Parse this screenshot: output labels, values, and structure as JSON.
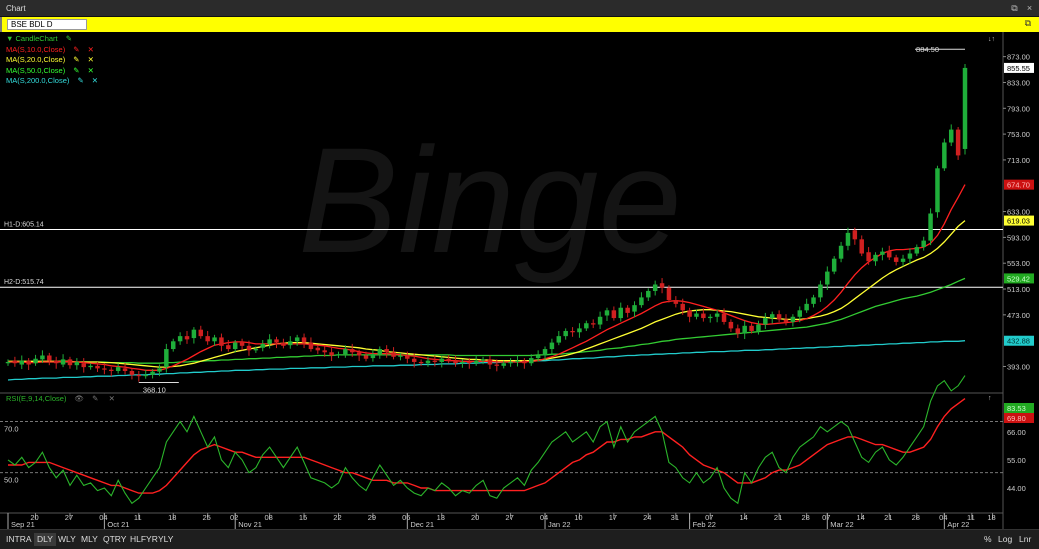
{
  "window": {
    "title": "Chart",
    "restore_glyph": "⧉",
    "close_glyph": "×",
    "undock_glyph": "⧉"
  },
  "symbol_bar": {
    "symbol": "BSE BDL D"
  },
  "watermark": "Binge",
  "legend": {
    "main": "▼ CandleChart",
    "studies": [
      {
        "label": "MA(S,10.0,Close)",
        "color": "#ff2020"
      },
      {
        "label": "MA(S,20.0,Close)",
        "color": "#ffff33"
      },
      {
        "label": "MA(S,50.0,Close)",
        "color": "#33ff33"
      },
      {
        "label": "MA(S,200.0,Close)",
        "color": "#33dddd"
      }
    ],
    "rsi": "RSI(E,9,14,Close)"
  },
  "colors": {
    "up": "#1fae3a",
    "down": "#d02020",
    "ma10": "#ff2020",
    "ma20": "#ffff33",
    "ma50": "#33cc33",
    "ma200": "#22cccc",
    "rsi": "#2bb52b",
    "rsi_sig": "#ff2020",
    "axis_text": "#cccccc",
    "hline": "#ffffff"
  },
  "chart_data": {
    "type": "candlestick",
    "y_ticks": [
      "873.00",
      "833.00",
      "793.00",
      "753.00",
      "713.00",
      "633.00",
      "593.00",
      "553.00",
      "513.00",
      "473.00",
      "393.00"
    ],
    "ylim": [
      355,
      905
    ],
    "last_price_label": "855.55",
    "ma_badges": [
      {
        "label": "674.70",
        "value": 674.7,
        "bg": "#cc1111",
        "fg": "#ffbbbb"
      },
      {
        "label": "619.03",
        "value": 619.03,
        "bg": "#ffff33",
        "fg": "#000000"
      },
      {
        "label": "529.42",
        "value": 529.42,
        "bg": "#22aa22",
        "fg": "#ccffcc"
      },
      {
        "label": "432.88",
        "value": 432.88,
        "bg": "#22cccc",
        "fg": "#003333"
      }
    ],
    "high_label": "884.50",
    "low_label": "368.10",
    "hlines": [
      {
        "label": "H1-D:605.14",
        "value": 605.14
      },
      {
        "label": "H2-D:515.74",
        "value": 515.74
      }
    ],
    "closes": [
      400,
      398,
      402,
      396,
      405,
      410,
      402,
      398,
      404,
      395,
      400,
      392,
      394,
      390,
      388,
      386,
      392,
      386,
      380,
      378,
      380,
      385,
      390,
      420,
      432,
      440,
      435,
      450,
      440,
      432,
      438,
      425,
      420,
      430,
      425,
      418,
      420,
      428,
      435,
      430,
      425,
      432,
      438,
      430,
      420,
      418,
      415,
      410,
      412,
      420,
      415,
      410,
      405,
      412,
      420,
      415,
      408,
      410,
      405,
      400,
      398,
      402,
      400,
      405,
      402,
      398,
      400,
      398,
      402,
      404,
      396,
      394,
      398,
      400,
      402,
      398,
      406,
      410,
      420,
      430,
      440,
      448,
      446,
      452,
      460,
      458,
      470,
      480,
      468,
      484,
      476,
      488,
      500,
      510,
      520,
      515,
      496,
      490,
      480,
      470,
      475,
      468,
      470,
      475,
      462,
      452,
      444,
      456,
      448,
      458,
      468,
      474,
      466,
      462,
      470,
      480,
      490,
      500,
      520,
      540,
      560,
      580,
      600,
      590,
      568,
      556,
      566,
      571,
      562,
      555,
      560,
      568,
      578,
      588,
      630,
      700,
      740,
      760,
      720,
      855.55
    ],
    "opens": [
      398,
      402,
      396,
      402,
      398,
      404,
      410,
      402,
      396,
      404,
      395,
      398,
      392,
      394,
      390,
      388,
      386,
      390,
      386,
      380,
      378,
      380,
      385,
      392,
      420,
      432,
      440,
      437,
      450,
      440,
      432,
      438,
      426,
      420,
      430,
      425,
      418,
      422,
      428,
      435,
      430,
      426,
      432,
      438,
      430,
      422,
      418,
      415,
      410,
      412,
      420,
      415,
      410,
      406,
      412,
      420,
      415,
      408,
      410,
      405,
      400,
      398,
      402,
      400,
      405,
      402,
      398,
      400,
      398,
      402,
      404,
      396,
      394,
      398,
      400,
      402,
      398,
      406,
      410,
      420,
      430,
      440,
      448,
      446,
      452,
      460,
      458,
      472,
      480,
      468,
      484,
      478,
      488,
      500,
      510,
      522,
      515,
      496,
      490,
      480,
      470,
      475,
      468,
      470,
      475,
      462,
      452,
      444,
      456,
      448,
      458,
      468,
      474,
      466,
      462,
      470,
      480,
      490,
      500,
      520,
      540,
      560,
      580,
      604,
      590,
      570,
      556,
      566,
      572,
      562,
      555,
      560,
      568,
      578,
      588,
      632,
      700,
      740,
      760,
      730
    ],
    "ma10": [
      400,
      400,
      400,
      399,
      399,
      400,
      400,
      400,
      401,
      400,
      400,
      399,
      398,
      397,
      396,
      394,
      393,
      392,
      390,
      389,
      387,
      387,
      387,
      390,
      394,
      399,
      404,
      410,
      416,
      421,
      426,
      428,
      430,
      431,
      431,
      430,
      428,
      428,
      428,
      428,
      428,
      428,
      428,
      428,
      427,
      426,
      425,
      423,
      421,
      420,
      418,
      416,
      414,
      413,
      413,
      413,
      412,
      411,
      410,
      409,
      407,
      405,
      404,
      403,
      402,
      402,
      401,
      401,
      401,
      401,
      401,
      400,
      400,
      400,
      400,
      400,
      401,
      402,
      405,
      408,
      412,
      417,
      422,
      427,
      432,
      438,
      444,
      450,
      455,
      460,
      465,
      470,
      475,
      481,
      487,
      492,
      494,
      495,
      494,
      492,
      489,
      486,
      483,
      480,
      476,
      472,
      468,
      464,
      461,
      459,
      458,
      459,
      460,
      461,
      462,
      464,
      467,
      472,
      478,
      486,
      496,
      508,
      522,
      535,
      546,
      555,
      562,
      568,
      572,
      574,
      574,
      575,
      576,
      578,
      584,
      596,
      614,
      636,
      655,
      674.7
    ],
    "ma20": [
      401,
      401,
      401,
      401,
      401,
      401,
      401,
      401,
      401,
      401,
      400,
      400,
      400,
      400,
      399,
      399,
      398,
      397,
      396,
      395,
      394,
      393,
      392,
      392,
      393,
      394,
      396,
      398,
      401,
      404,
      407,
      410,
      413,
      416,
      418,
      420,
      422,
      424,
      426,
      428,
      429,
      430,
      430,
      430,
      429,
      428,
      427,
      426,
      425,
      424,
      423,
      422,
      420,
      419,
      418,
      416,
      415,
      414,
      413,
      412,
      411,
      410,
      409,
      408,
      407,
      406,
      405,
      404,
      404,
      403,
      403,
      402,
      402,
      402,
      402,
      402,
      402,
      403,
      404,
      406,
      408,
      410,
      413,
      416,
      420,
      424,
      428,
      432,
      436,
      440,
      444,
      448,
      452,
      457,
      462,
      466,
      470,
      474,
      477,
      479,
      480,
      481,
      481,
      480,
      479,
      478,
      476,
      474,
      472,
      470,
      469,
      468,
      467,
      466,
      466,
      466,
      467,
      469,
      471,
      474,
      478,
      483,
      490,
      498,
      506,
      514,
      522,
      530,
      537,
      543,
      548,
      553,
      558,
      562,
      568,
      576,
      586,
      598,
      610,
      619.03
    ],
    "ma50": [
      400,
      400,
      400,
      400,
      400,
      400,
      400,
      400,
      400,
      400,
      400,
      400,
      400,
      400,
      400,
      399,
      399,
      399,
      399,
      398,
      398,
      398,
      398,
      399,
      399,
      400,
      400,
      401,
      401,
      402,
      402,
      403,
      403,
      404,
      404,
      405,
      405,
      406,
      406,
      407,
      407,
      408,
      408,
      409,
      409,
      410,
      410,
      410,
      411,
      411,
      411,
      411,
      411,
      411,
      411,
      411,
      411,
      411,
      411,
      411,
      411,
      411,
      411,
      411,
      411,
      410,
      410,
      410,
      410,
      410,
      410,
      410,
      410,
      410,
      410,
      410,
      410,
      411,
      411,
      412,
      412,
      413,
      414,
      415,
      416,
      417,
      418,
      420,
      421,
      422,
      424,
      425,
      427,
      428,
      430,
      432,
      433,
      435,
      436,
      437,
      438,
      439,
      440,
      441,
      442,
      443,
      444,
      445,
      446,
      447,
      448,
      449,
      450,
      451,
      452,
      453,
      454,
      456,
      458,
      460,
      463,
      466,
      470,
      474,
      478,
      482,
      486,
      489,
      492,
      495,
      498,
      500,
      502,
      505,
      508,
      512,
      516,
      520,
      525,
      529.42
    ],
    "ma200": [
      372,
      373,
      373,
      374,
      374,
      375,
      375,
      375,
      376,
      376,
      376,
      377,
      377,
      378,
      378,
      378,
      379,
      379,
      380,
      380,
      380,
      381,
      381,
      382,
      382,
      383,
      383,
      384,
      384,
      385,
      385,
      386,
      386,
      387,
      387,
      387,
      388,
      388,
      389,
      389,
      389,
      390,
      390,
      390,
      391,
      391,
      391,
      392,
      392,
      392,
      393,
      393,
      393,
      394,
      394,
      394,
      394,
      395,
      395,
      395,
      396,
      396,
      396,
      397,
      397,
      397,
      398,
      398,
      398,
      399,
      399,
      399,
      400,
      400,
      400,
      401,
      401,
      402,
      402,
      403,
      403,
      404,
      405,
      405,
      406,
      406,
      407,
      408,
      408,
      409,
      410,
      410,
      411,
      411,
      412,
      412,
      413,
      413,
      414,
      414,
      415,
      415,
      416,
      416,
      416,
      417,
      417,
      418,
      418,
      418,
      419,
      419,
      420,
      420,
      421,
      421,
      422,
      422,
      423,
      423,
      424,
      424,
      425,
      425,
      426,
      426,
      427,
      427,
      428,
      428,
      429,
      429,
      430,
      430,
      431,
      431,
      432,
      432,
      432,
      432.88
    ],
    "rsi": {
      "y_ticks": [
        "66.00",
        "55.00",
        "44.00"
      ],
      "ylim": [
        35,
        80
      ],
      "levels": [
        {
          "label": "70.0",
          "value": 70
        },
        {
          "label": "50.0",
          "value": 50
        }
      ],
      "badges": [
        {
          "label": "83.53",
          "value": 83.53,
          "bg": "#22aa22",
          "fg": "#ccffcc"
        },
        {
          "label": "69.80",
          "value": 69.8,
          "bg": "#cc1111",
          "fg": "#ffbbbb"
        }
      ],
      "values": [
        55,
        53,
        56,
        52,
        54,
        58,
        52,
        48,
        51,
        45,
        49,
        45,
        46,
        43,
        44,
        41,
        47,
        42,
        38,
        40,
        44,
        48,
        52,
        62,
        66,
        70,
        66,
        72,
        66,
        60,
        64,
        55,
        52,
        58,
        55,
        50,
        52,
        57,
        60,
        56,
        52,
        56,
        60,
        54,
        48,
        47,
        46,
        44,
        46,
        52,
        48,
        45,
        43,
        48,
        53,
        49,
        45,
        47,
        44,
        42,
        41,
        44,
        43,
        46,
        44,
        41,
        43,
        42,
        45,
        47,
        41,
        40,
        44,
        46,
        48,
        45,
        51,
        54,
        58,
        62,
        64,
        66,
        62,
        64,
        66,
        62,
        68,
        70,
        60,
        68,
        62,
        66,
        68,
        70,
        72,
        66,
        54,
        52,
        48,
        46,
        50,
        46,
        48,
        52,
        44,
        40,
        38,
        50,
        46,
        52,
        56,
        58,
        52,
        50,
        56,
        60,
        62,
        64,
        68,
        66,
        68,
        70,
        68,
        62,
        56,
        54,
        58,
        60,
        55,
        53,
        56,
        60,
        64,
        68,
        78,
        84,
        86,
        82,
        84,
        88
      ],
      "signal": [
        53,
        53,
        53,
        54,
        54,
        54,
        54,
        53,
        52,
        51,
        50,
        49,
        48,
        47,
        46,
        45,
        45,
        44,
        43,
        42,
        42,
        42,
        43,
        45,
        48,
        51,
        54,
        57,
        59,
        60,
        61,
        60,
        59,
        58,
        58,
        57,
        56,
        56,
        56,
        56,
        56,
        56,
        56,
        56,
        55,
        54,
        53,
        52,
        51,
        50,
        50,
        49,
        48,
        47,
        47,
        47,
        46,
        46,
        46,
        45,
        44,
        44,
        43,
        43,
        43,
        43,
        43,
        43,
        43,
        43,
        43,
        43,
        43,
        43,
        43,
        43,
        44,
        45,
        46,
        48,
        50,
        52,
        54,
        55,
        57,
        58,
        60,
        62,
        62,
        63,
        63,
        64,
        64,
        65,
        66,
        66,
        64,
        62,
        60,
        57,
        55,
        53,
        52,
        51,
        50,
        48,
        46,
        46,
        46,
        47,
        48,
        50,
        51,
        51,
        52,
        53,
        55,
        57,
        59,
        61,
        62,
        63,
        64,
        64,
        63,
        62,
        61,
        61,
        60,
        59,
        58,
        58,
        59,
        60,
        63,
        68,
        72,
        75,
        77,
        79
      ]
    },
    "x_labels": [
      {
        "i": 0,
        "top": "",
        "bottom": "Sep 21"
      },
      {
        "i": 4,
        "top": "20",
        "bottom": ""
      },
      {
        "i": 9,
        "top": "27",
        "bottom": ""
      },
      {
        "i": 14,
        "top": "04",
        "bottom": "Oct 21"
      },
      {
        "i": 19,
        "top": "11",
        "bottom": ""
      },
      {
        "i": 24,
        "top": "18",
        "bottom": ""
      },
      {
        "i": 29,
        "top": "25",
        "bottom": ""
      },
      {
        "i": 33,
        "top": "02",
        "bottom": "Nov 21"
      },
      {
        "i": 38,
        "top": "08",
        "bottom": ""
      },
      {
        "i": 43,
        "top": "15",
        "bottom": ""
      },
      {
        "i": 48,
        "top": "22",
        "bottom": ""
      },
      {
        "i": 53,
        "top": "29",
        "bottom": ""
      },
      {
        "i": 58,
        "top": "06",
        "bottom": "Dec 21"
      },
      {
        "i": 63,
        "top": "13",
        "bottom": ""
      },
      {
        "i": 68,
        "top": "20",
        "bottom": ""
      },
      {
        "i": 73,
        "top": "27",
        "bottom": ""
      },
      {
        "i": 78,
        "top": "04",
        "bottom": "Jan 22"
      },
      {
        "i": 83,
        "top": "10",
        "bottom": ""
      },
      {
        "i": 88,
        "top": "17",
        "bottom": ""
      },
      {
        "i": 93,
        "top": "24",
        "bottom": ""
      },
      {
        "i": 97,
        "top": "31",
        "bottom": ""
      },
      {
        "i": 99,
        "top": "",
        "bottom": "Feb 22"
      },
      {
        "i": 102,
        "top": "07",
        "bottom": ""
      },
      {
        "i": 107,
        "top": "14",
        "bottom": ""
      },
      {
        "i": 112,
        "top": "21",
        "bottom": ""
      },
      {
        "i": 116,
        "top": "28",
        "bottom": ""
      },
      {
        "i": 119,
        "top": "07",
        "bottom": "Mar 22"
      },
      {
        "i": 124,
        "top": "14",
        "bottom": ""
      },
      {
        "i": 128,
        "top": "21",
        "bottom": ""
      },
      {
        "i": 132,
        "top": "28",
        "bottom": ""
      },
      {
        "i": 136,
        "top": "04",
        "bottom": "Apr 22"
      },
      {
        "i": 140,
        "top": "11",
        "bottom": ""
      },
      {
        "i": 143,
        "top": "18",
        "bottom": ""
      }
    ]
  },
  "periods": [
    "INTRA",
    "DLY",
    "WLY",
    "MLY",
    "QTRY",
    "HLFYR",
    "YLY"
  ],
  "active_period": "DLY",
  "scale_buttons": [
    "%",
    "Log",
    "Lnr"
  ]
}
